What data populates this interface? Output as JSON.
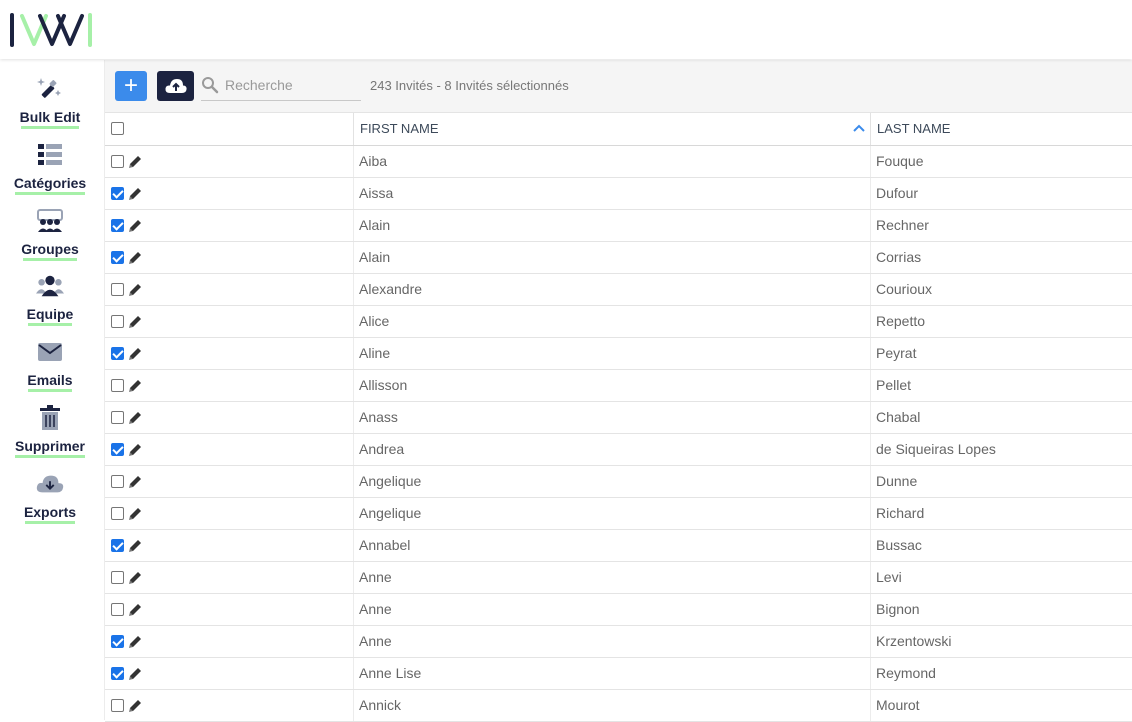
{
  "app": {
    "logo_text": "IVVI"
  },
  "colors": {
    "brand_navy": "#1c2340",
    "brand_green": "#a6f0a8",
    "accent_blue": "#3b8beb"
  },
  "sidebar": {
    "items": [
      {
        "label": "Bulk Edit",
        "icon": "magic-wand-icon"
      },
      {
        "label": "Catégories",
        "icon": "list-icon"
      },
      {
        "label": "Groupes",
        "icon": "group-icon"
      },
      {
        "label": "Equipe",
        "icon": "team-icon"
      },
      {
        "label": "Emails",
        "icon": "envelope-icon"
      },
      {
        "label": "Supprimer",
        "icon": "trash-icon"
      },
      {
        "label": "Exports",
        "icon": "cloud-download-icon"
      }
    ]
  },
  "toolbar": {
    "add_label": "+",
    "upload_icon": "cloud-upload-icon",
    "search_placeholder": "Recherche",
    "count_text": "243 Invités - 8 Invités sélectionnés"
  },
  "table": {
    "columns": [
      "FIRST NAME",
      "LAST NAME"
    ],
    "sort": "first_name ascending",
    "rows": [
      {
        "first": "Aiba",
        "last": "Fouque",
        "selected": false
      },
      {
        "first": "Aissa",
        "last": "Dufour",
        "selected": true
      },
      {
        "first": "Alain",
        "last": "Rechner",
        "selected": true
      },
      {
        "first": "Alain",
        "last": "Corrias",
        "selected": true
      },
      {
        "first": "Alexandre",
        "last": "Courioux",
        "selected": false
      },
      {
        "first": "Alice",
        "last": "Repetto",
        "selected": false
      },
      {
        "first": "Aline",
        "last": "Peyrat",
        "selected": true
      },
      {
        "first": "Allisson",
        "last": "Pellet",
        "selected": false
      },
      {
        "first": "Anass",
        "last": "Chabal",
        "selected": false
      },
      {
        "first": "Andrea",
        "last": "de Siqueiras Lopes",
        "selected": true
      },
      {
        "first": "Angelique",
        "last": "Dunne",
        "selected": false
      },
      {
        "first": "Angelique",
        "last": "Richard",
        "selected": false
      },
      {
        "first": "Annabel",
        "last": "Bussac",
        "selected": true
      },
      {
        "first": "Anne",
        "last": "Levi",
        "selected": false
      },
      {
        "first": "Anne",
        "last": "Bignon",
        "selected": false
      },
      {
        "first": "Anne",
        "last": "Krzentowski",
        "selected": true
      },
      {
        "first": "Anne Lise",
        "last": "Reymond",
        "selected": true
      },
      {
        "first": "Annick",
        "last": "Mourot",
        "selected": false
      }
    ]
  }
}
